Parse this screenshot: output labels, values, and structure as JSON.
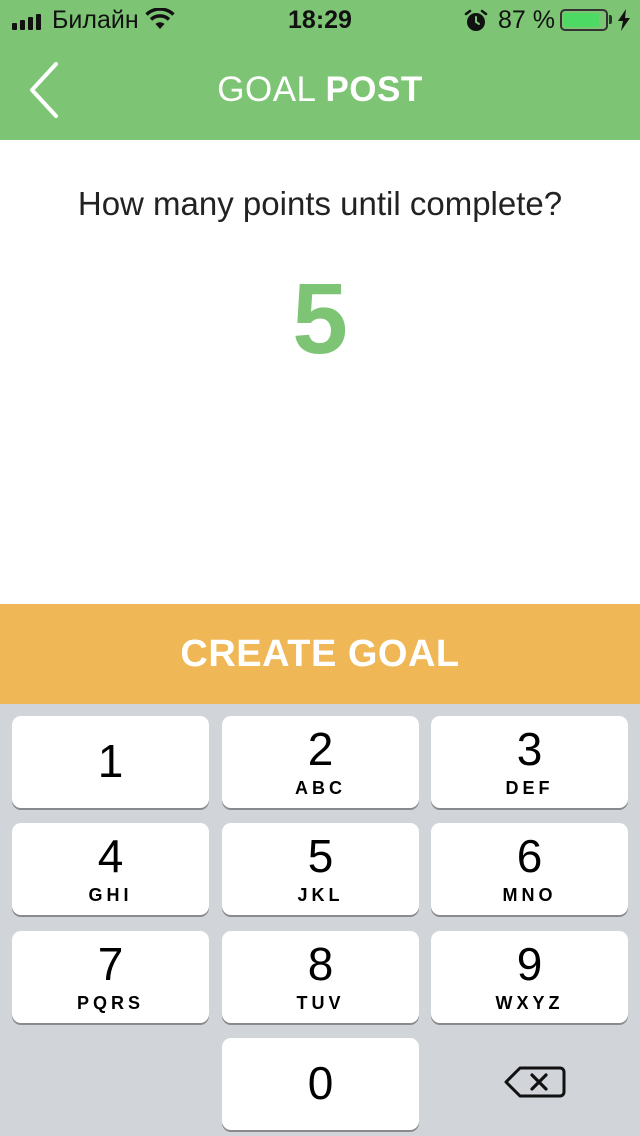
{
  "status_bar": {
    "carrier": "Билайн",
    "time": "18:29",
    "battery_percent": "87 %",
    "battery_level": 0.87,
    "icons": [
      "signal-icon",
      "wifi-icon",
      "alarm-icon",
      "battery-icon",
      "charging-bolt-icon"
    ]
  },
  "header": {
    "title_light": "GOAL",
    "title_bold": "POST",
    "back_icon": "chevron-left-icon",
    "background": "#7dc574"
  },
  "main": {
    "question": "How many points until complete?",
    "points_value": "5",
    "value_color": "#7dc574"
  },
  "create_button": {
    "label": "CREATE GOAL",
    "background": "#efb755"
  },
  "keypad": {
    "keys": [
      {
        "digit": "1",
        "letters": ""
      },
      {
        "digit": "2",
        "letters": "ABC"
      },
      {
        "digit": "3",
        "letters": "DEF"
      },
      {
        "digit": "4",
        "letters": "GHI"
      },
      {
        "digit": "5",
        "letters": "JKL"
      },
      {
        "digit": "6",
        "letters": "MNO"
      },
      {
        "digit": "7",
        "letters": "PQRS"
      },
      {
        "digit": "8",
        "letters": "TUV"
      },
      {
        "digit": "9",
        "letters": "WXYZ"
      },
      {
        "digit": "0",
        "letters": ""
      }
    ],
    "delete_icon": "backspace-icon"
  }
}
